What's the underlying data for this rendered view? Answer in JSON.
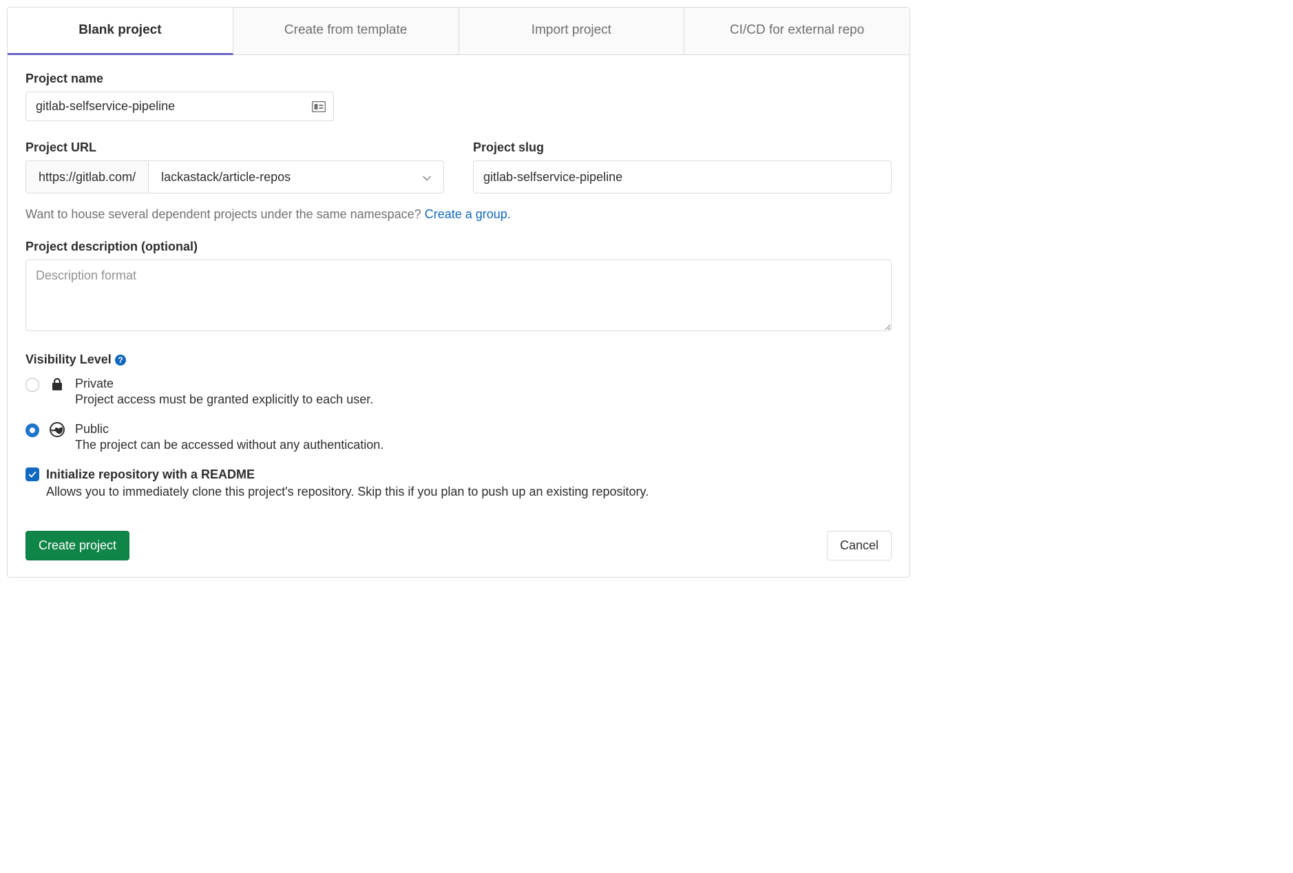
{
  "tabs": {
    "blank": "Blank project",
    "template": "Create from template",
    "import": "Import project",
    "cicd": "CI/CD for external repo"
  },
  "labels": {
    "project_name": "Project name",
    "project_url": "Project URL",
    "project_slug": "Project slug",
    "project_description": "Project description (optional)",
    "visibility_level": "Visibility Level"
  },
  "fields": {
    "project_name_value": "gitlab-selfservice-pipeline",
    "url_prefix": "https://gitlab.com/",
    "namespace_value": "lackastack/article-repos",
    "slug_value": "gitlab-selfservice-pipeline",
    "description_placeholder": "Description format"
  },
  "hint": {
    "text": "Want to house several dependent projects under the same namespace? ",
    "link": "Create a group."
  },
  "visibility": {
    "private_label": "Private",
    "private_desc": "Project access must be granted explicitly to each user.",
    "public_label": "Public",
    "public_desc": "The project can be accessed without any authentication."
  },
  "readme": {
    "title": "Initialize repository with a README",
    "desc": "Allows you to immediately clone this project's repository. Skip this if you plan to push up an existing repository."
  },
  "buttons": {
    "create": "Create project",
    "cancel": "Cancel"
  }
}
